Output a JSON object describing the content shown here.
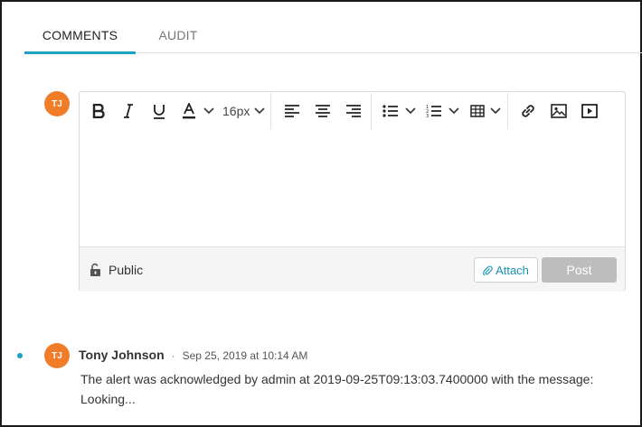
{
  "tabs": [
    {
      "label": "COMMENTS",
      "active": true
    },
    {
      "label": "AUDIT",
      "active": false
    }
  ],
  "current_user": {
    "initials": "TJ"
  },
  "toolbar": {
    "font_size": "16px",
    "icons": [
      "bold-icon",
      "italic-icon",
      "underline-icon",
      "font-color-icon",
      "align-left-icon",
      "align-center-icon",
      "align-right-icon",
      "bulleted-list-icon",
      "numbered-list-icon",
      "table-icon",
      "link-icon",
      "image-icon",
      "video-icon"
    ]
  },
  "editor_footer": {
    "visibility_label": "Public",
    "attach_label": "Attach",
    "post_label": "Post"
  },
  "colors": {
    "accent": "#1aa3c7",
    "avatar": "#f07c28",
    "post_disabled": "#bdbdbd"
  },
  "comments": [
    {
      "initials": "TJ",
      "author": "Tony Johnson",
      "separator": "·",
      "timestamp": "Sep 25, 2019 at 10:14 AM",
      "body": "The alert was acknowledged by admin at 2019-09-25T09:13:03.7400000 with the message: Looking..."
    }
  ]
}
